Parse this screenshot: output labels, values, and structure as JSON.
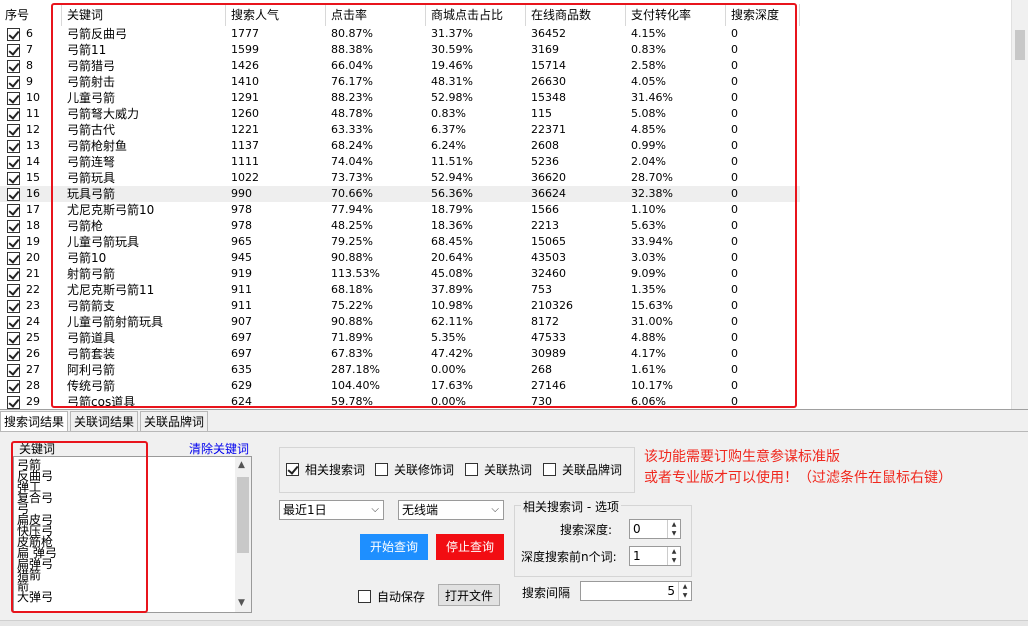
{
  "table": {
    "headers": [
      "序号",
      "关键词",
      "搜索人气",
      "点击率",
      "商城点击占比",
      "在线商品数",
      "支付转化率",
      "搜索深度"
    ],
    "rows": [
      {
        "no": "6",
        "kw": "弓箭反曲弓",
        "pop": "1777",
        "ctr": "80.87%",
        "mall": "31.37%",
        "online": "36452",
        "conv": "4.15%",
        "depth": "0"
      },
      {
        "no": "7",
        "kw": "弓箭11",
        "pop": "1599",
        "ctr": "88.38%",
        "mall": "30.59%",
        "online": "3169",
        "conv": "0.83%",
        "depth": "0"
      },
      {
        "no": "8",
        "kw": "弓箭猎弓",
        "pop": "1426",
        "ctr": "66.04%",
        "mall": "19.46%",
        "online": "15714",
        "conv": "2.58%",
        "depth": "0"
      },
      {
        "no": "9",
        "kw": "弓箭射击",
        "pop": "1410",
        "ctr": "76.17%",
        "mall": "48.31%",
        "online": "26630",
        "conv": "4.05%",
        "depth": "0"
      },
      {
        "no": "10",
        "kw": "儿童弓箭",
        "pop": "1291",
        "ctr": "88.23%",
        "mall": "52.98%",
        "online": "15348",
        "conv": "31.46%",
        "depth": "0"
      },
      {
        "no": "11",
        "kw": "弓箭弩大威力",
        "pop": "1260",
        "ctr": "48.78%",
        "mall": "0.83%",
        "online": "115",
        "conv": "5.08%",
        "depth": "0"
      },
      {
        "no": "12",
        "kw": "弓箭古代",
        "pop": "1221",
        "ctr": "63.33%",
        "mall": "6.37%",
        "online": "22371",
        "conv": "4.85%",
        "depth": "0"
      },
      {
        "no": "13",
        "kw": "弓箭枪射鱼",
        "pop": "1137",
        "ctr": "68.24%",
        "mall": "6.24%",
        "online": "2608",
        "conv": "0.99%",
        "depth": "0"
      },
      {
        "no": "14",
        "kw": "弓箭连弩",
        "pop": "1111",
        "ctr": "74.04%",
        "mall": "11.51%",
        "online": "5236",
        "conv": "2.04%",
        "depth": "0"
      },
      {
        "no": "15",
        "kw": "弓箭玩具",
        "pop": "1022",
        "ctr": "73.73%",
        "mall": "52.94%",
        "online": "36620",
        "conv": "28.70%",
        "depth": "0"
      },
      {
        "no": "16",
        "kw": "玩具弓箭",
        "pop": "990",
        "ctr": "70.66%",
        "mall": "56.36%",
        "online": "36624",
        "conv": "32.38%",
        "depth": "0"
      },
      {
        "no": "17",
        "kw": "尤尼克斯弓箭10",
        "pop": "978",
        "ctr": "77.94%",
        "mall": "18.79%",
        "online": "1566",
        "conv": "1.10%",
        "depth": "0"
      },
      {
        "no": "18",
        "kw": "弓箭枪",
        "pop": "978",
        "ctr": "48.25%",
        "mall": "18.36%",
        "online": "2213",
        "conv": "5.63%",
        "depth": "0"
      },
      {
        "no": "19",
        "kw": "儿童弓箭玩具",
        "pop": "965",
        "ctr": "79.25%",
        "mall": "68.45%",
        "online": "15065",
        "conv": "33.94%",
        "depth": "0"
      },
      {
        "no": "20",
        "kw": "弓箭10",
        "pop": "945",
        "ctr": "90.88%",
        "mall": "20.64%",
        "online": "43503",
        "conv": "3.03%",
        "depth": "0"
      },
      {
        "no": "21",
        "kw": "射箭弓箭",
        "pop": "919",
        "ctr": "113.53%",
        "mall": "45.08%",
        "online": "32460",
        "conv": "9.09%",
        "depth": "0"
      },
      {
        "no": "22",
        "kw": "尤尼克斯弓箭11",
        "pop": "911",
        "ctr": "68.18%",
        "mall": "37.89%",
        "online": "753",
        "conv": "1.35%",
        "depth": "0"
      },
      {
        "no": "23",
        "kw": "弓箭箭支",
        "pop": "911",
        "ctr": "75.22%",
        "mall": "10.98%",
        "online": "210326",
        "conv": "15.63%",
        "depth": "0"
      },
      {
        "no": "24",
        "kw": "儿童弓箭射箭玩具",
        "pop": "907",
        "ctr": "90.88%",
        "mall": "62.11%",
        "online": "8172",
        "conv": "31.00%",
        "depth": "0"
      },
      {
        "no": "25",
        "kw": "弓箭道具",
        "pop": "697",
        "ctr": "71.89%",
        "mall": "5.35%",
        "online": "47533",
        "conv": "4.88%",
        "depth": "0"
      },
      {
        "no": "26",
        "kw": "弓箭套装",
        "pop": "697",
        "ctr": "67.83%",
        "mall": "47.42%",
        "online": "30989",
        "conv": "4.17%",
        "depth": "0"
      },
      {
        "no": "27",
        "kw": "阿利弓箭",
        "pop": "635",
        "ctr": "287.18%",
        "mall": "0.00%",
        "online": "268",
        "conv": "1.61%",
        "depth": "0"
      },
      {
        "no": "28",
        "kw": "传统弓箭",
        "pop": "629",
        "ctr": "104.40%",
        "mall": "17.63%",
        "online": "27146",
        "conv": "10.17%",
        "depth": "0"
      },
      {
        "no": "29",
        "kw": "弓箭cos道具",
        "pop": "624",
        "ctr": "59.78%",
        "mall": "0.00%",
        "online": "730",
        "conv": "6.06%",
        "depth": "0"
      }
    ]
  },
  "tabs": [
    "搜索词结果",
    "关联词结果",
    "关联品牌词"
  ],
  "keywords": {
    "group_label": "关键词",
    "clear_label": "清除关键词",
    "items": [
      "弓箭",
      "反曲弓",
      "弹工",
      "复合弓",
      "弓",
      "扁皮弓",
      "快压弓",
      "皮筋枪",
      "扁 弹弓",
      "扁弹弓",
      "猎箭",
      "箭",
      "大弹弓"
    ]
  },
  "options": {
    "related_search": "相关搜索词",
    "modifier": "关联修饰词",
    "hot": "关联热词",
    "brand": "关联品牌词",
    "period": "最近1日",
    "device": "无线端",
    "start": "开始查询",
    "stop": "停止查询",
    "autosave": "自动保存",
    "open_file": "打开文件",
    "group_title": "相关搜索词 - 选项",
    "depth_label": "搜索深度:",
    "depth_value": "0",
    "topn_label": "深度搜索前n个词:",
    "topn_value": "1",
    "interval_label": "搜索间隔",
    "interval_value": "5"
  },
  "notice": {
    "line1": "该功能需要订购生意参谋标准版",
    "line2": "或者专业版才可以使用！（过滤条件在鼠标右键）"
  },
  "colors": {
    "highlight_box": "#e8141c",
    "start_button": "#1e8fff",
    "stop_button": "#f20d12",
    "notice": "#f0281e"
  }
}
